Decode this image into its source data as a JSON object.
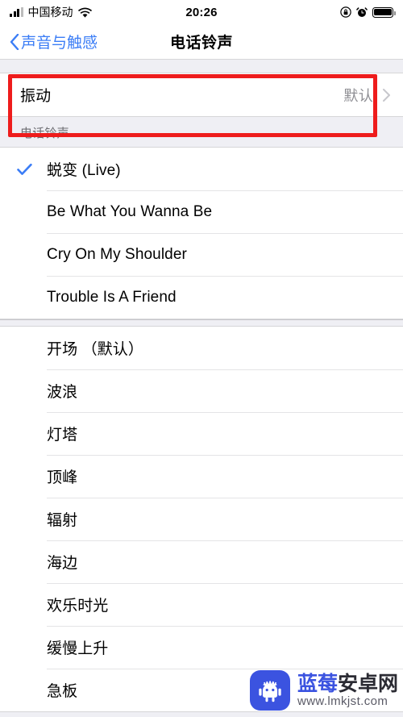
{
  "status_bar": {
    "carrier": "中国移动",
    "time": "20:26",
    "signal_icon": "signal-bars-icon",
    "wifi_icon": "wifi-icon",
    "rotation_lock_icon": "rotation-lock-icon",
    "alarm_icon": "alarm-clock-icon",
    "battery_icon": "battery-full-icon"
  },
  "nav": {
    "back_label": "声音与触感",
    "back_icon": "chevron-left-icon",
    "title": "电话铃声"
  },
  "vibration_row": {
    "label": "振动",
    "value": "默认",
    "chevron_icon": "chevron-right-icon"
  },
  "section": {
    "header": "电话铃声"
  },
  "ringtones_custom": [
    {
      "name": "蜕变 (Live)",
      "selected": true
    },
    {
      "name": "Be What You Wanna Be",
      "selected": false
    },
    {
      "name": "Cry On My Shoulder",
      "selected": false
    },
    {
      "name": "Trouble Is A Friend",
      "selected": false
    }
  ],
  "ringtones_system": [
    {
      "name": "开场 （默认）",
      "selected": false
    },
    {
      "name": "波浪",
      "selected": false
    },
    {
      "name": "灯塔",
      "selected": false
    },
    {
      "name": "顶峰",
      "selected": false
    },
    {
      "name": "辐射",
      "selected": false
    },
    {
      "name": "海边",
      "selected": false
    },
    {
      "name": "欢乐时光",
      "selected": false
    },
    {
      "name": "缓慢上升",
      "selected": false
    },
    {
      "name": "急板",
      "selected": false
    }
  ],
  "annotation": {
    "color": "#EE1C1C"
  },
  "watermark": {
    "brand_blue": "蓝莓",
    "brand_dark": "安卓网",
    "url": "www.lmkjst.com",
    "logo_icon": "android-robot-icon",
    "logo_color": "#3B53E0"
  },
  "colors": {
    "accent": "#3B7DF6",
    "check": "#3B7DF6",
    "group_bg": "#EFEFF4",
    "cell_bg": "#FFFFFF",
    "separator": "#D6D6D8",
    "secondary_text": "#8E8E93"
  }
}
